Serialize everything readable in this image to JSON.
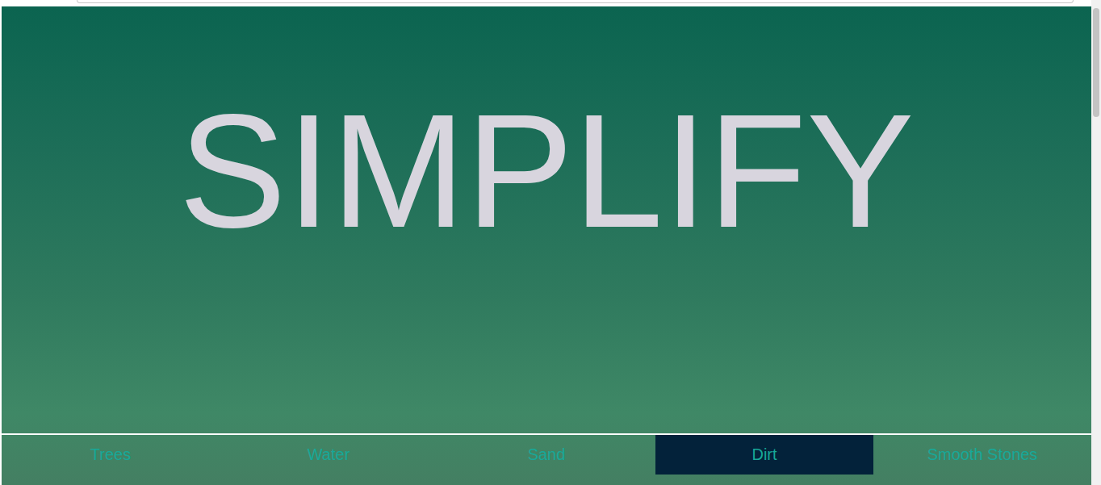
{
  "title": "SIMPLIFY",
  "nav": [
    {
      "label": "Trees",
      "selected": false
    },
    {
      "label": "Water",
      "selected": false
    },
    {
      "label": "Sand",
      "selected": false
    },
    {
      "label": "Dirt",
      "selected": true
    },
    {
      "label": "Smooth Stones",
      "selected": false
    }
  ]
}
